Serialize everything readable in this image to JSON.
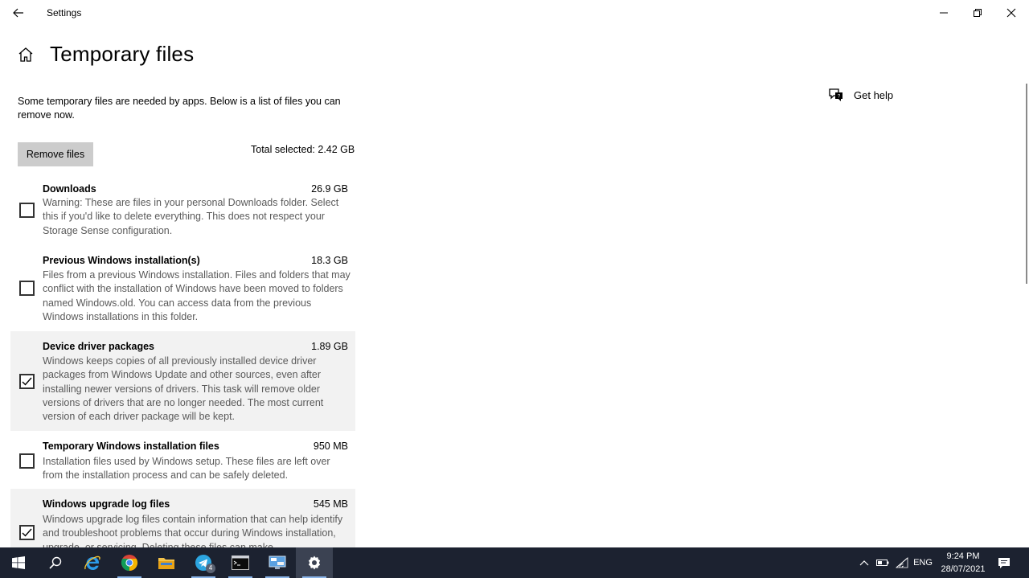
{
  "window": {
    "title": "Settings"
  },
  "page": {
    "title": "Temporary files",
    "intro": "Some temporary files are needed by apps. Below is a list of files you can remove now.",
    "remove_button": "Remove files",
    "total_selected": "Total selected: 2.42 GB"
  },
  "items": [
    {
      "name": "Downloads",
      "size": "26.9 GB",
      "checked": false,
      "description": "Warning: These are files in your personal Downloads folder. Select this if you'd like to delete everything. This does not respect your Storage Sense configuration."
    },
    {
      "name": "Previous Windows installation(s)",
      "size": "18.3 GB",
      "checked": false,
      "description": "Files from a previous Windows installation.  Files and folders that may conflict with the installation of Windows have been moved to folders named Windows.old.  You can access data from the previous Windows installations in this folder."
    },
    {
      "name": "Device driver packages",
      "size": "1.89 GB",
      "checked": true,
      "description": "Windows keeps copies of all previously installed device driver packages from Windows Update and other sources, even after installing newer versions of drivers. This task will remove older versions of drivers that are no longer needed. The most current version of each driver package will be kept."
    },
    {
      "name": "Temporary Windows installation files",
      "size": "950 MB",
      "checked": false,
      "description": "Installation files used by Windows setup.  These files are left over from the installation process and can be safely deleted."
    },
    {
      "name": "Windows upgrade log files",
      "size": "545 MB",
      "checked": true,
      "description": "Windows upgrade log files contain information that can help identify and troubleshoot problems that occur during Windows installation, upgrade, or servicing.  Deleting these files can make"
    }
  ],
  "help": {
    "label": "Get help"
  },
  "taskbar": {
    "apps": [
      "windows-start",
      "search",
      "internet-explorer",
      "chrome",
      "file-explorer",
      "telegram",
      "command-prompt",
      "remote-desktop",
      "settings"
    ],
    "telegram_badge": "4",
    "language": "ENG",
    "time": "9:24 PM",
    "date": "28/07/2021"
  },
  "colors": {
    "selected_row": "#f2f2f2",
    "button": "#cccccc",
    "taskbar": "#1c2230",
    "description_text": "#5a5a5a"
  }
}
